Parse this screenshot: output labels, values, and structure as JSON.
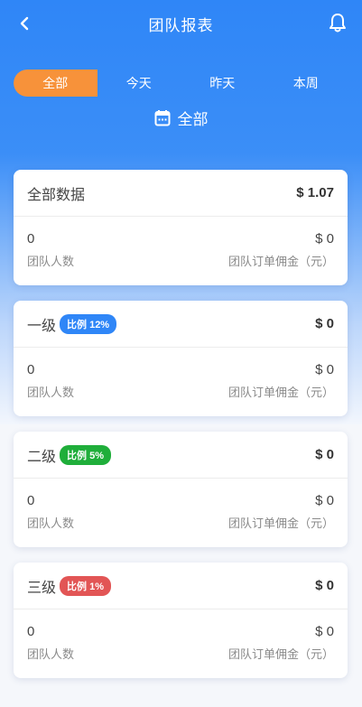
{
  "header": {
    "title": "团队报表"
  },
  "tabs": [
    {
      "label": "全部",
      "active": true
    },
    {
      "label": "今天",
      "active": false
    },
    {
      "label": "昨天",
      "active": false
    },
    {
      "label": "本周",
      "active": false
    }
  ],
  "range": {
    "label": "全部"
  },
  "summary": {
    "title": "全部数据",
    "amount": "$ 1.07",
    "members_value": "0",
    "members_label": "团队人数",
    "commission_value": "$ 0",
    "commission_label": "团队订单佣金（元）"
  },
  "levels": [
    {
      "title": "一级",
      "badge": "比例 12%",
      "badge_color": "#2f86f7",
      "amount": "$ 0",
      "members_value": "0",
      "members_label": "团队人数",
      "commission_value": "$ 0",
      "commission_label": "团队订单佣金（元）"
    },
    {
      "title": "二级",
      "badge": "比例 5%",
      "badge_color": "#1fae3a",
      "amount": "$ 0",
      "members_value": "0",
      "members_label": "团队人数",
      "commission_value": "$ 0",
      "commission_label": "团队订单佣金（元）"
    },
    {
      "title": "三级",
      "badge": "比例 1%",
      "badge_color": "#e25555",
      "amount": "$ 0",
      "members_value": "0",
      "members_label": "团队人数",
      "commission_value": "$ 0",
      "commission_label": "团队订单佣金（元）"
    }
  ],
  "colors": {
    "primary": "#2f86f7",
    "active_tab": "#f7923a"
  }
}
